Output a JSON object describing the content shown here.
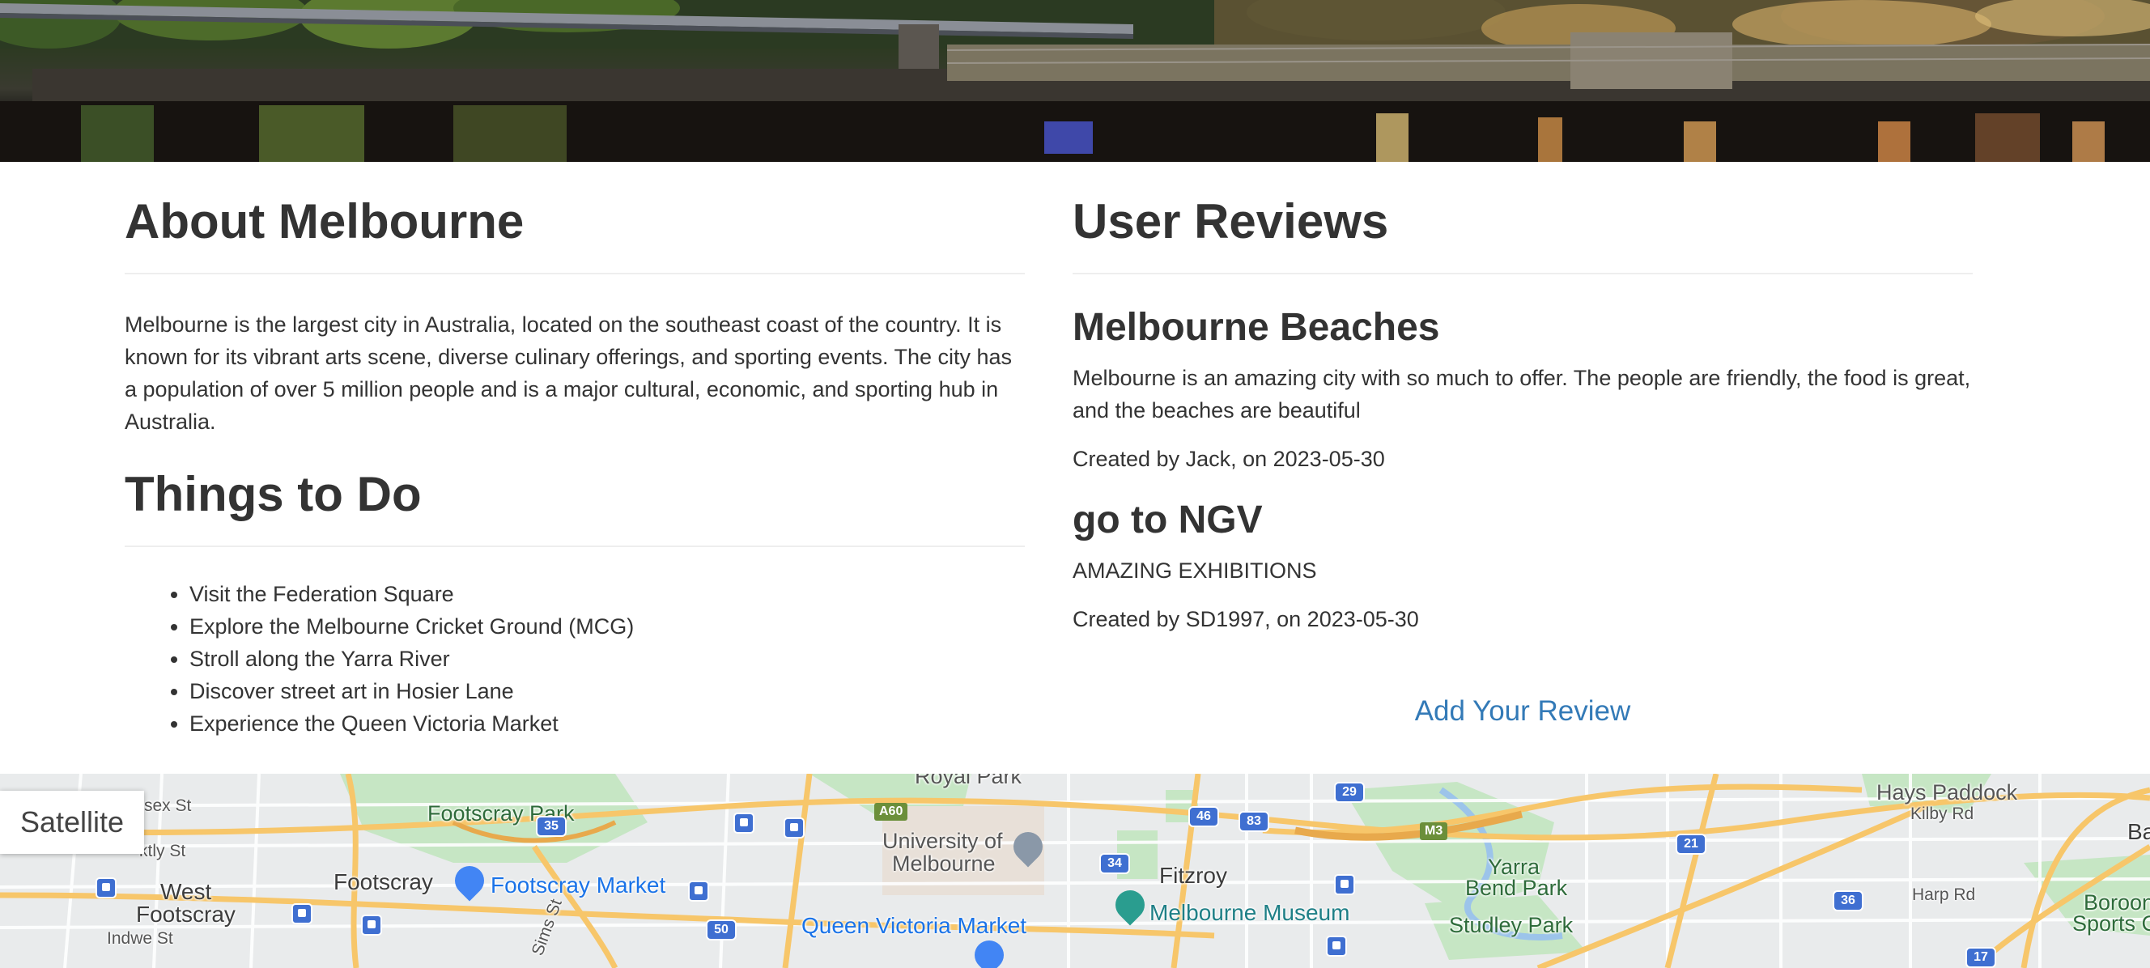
{
  "about": {
    "heading": "About Melbourne",
    "text": "Melbourne is the largest city in Australia, located on the southeast coast of the country. It is known for its vibrant arts scene, diverse culinary offerings, and sporting events. The city has a population of over 5 million people and is a major cultural, economic, and sporting hub in Australia."
  },
  "things": {
    "heading": "Things to Do",
    "items": [
      "Visit the Federation Square",
      "Explore the Melbourne Cricket Ground (MCG)",
      "Stroll along the Yarra River",
      "Discover street art in Hosier Lane",
      "Experience the Queen Victoria Market"
    ]
  },
  "reviews": {
    "heading": "User Reviews",
    "items": [
      {
        "title": "Melbourne Beaches",
        "body": "Melbourne is an amazing city with so much to offer. The people are friendly, the food is great, and the beaches are beautiful",
        "meta": "Created by Jack, on 2023-05-30"
      },
      {
        "title": "go to NGV",
        "body": "AMAZING EXHIBITIONS",
        "meta": "Created by SD1997, on 2023-05-30"
      }
    ],
    "add_label": "Add Your Review"
  },
  "map": {
    "satellite_label": "Satellite",
    "labels": {
      "royal_park": "Royal Park",
      "hays_paddock": "Hays Paddock",
      "kilby_rd": "Kilby Rd",
      "ba": "Ba",
      "sex_st": "sex St",
      "footscray_park": "Footscray Park",
      "a60": "A60",
      "uni_line1": "University of",
      "uni_line2": "Melbourne",
      "m3": "M3",
      "ktly_st": "ktly St",
      "west": "West",
      "footscray": "Footscray",
      "footscray_market": "Footscray Market",
      "fitzroy": "Fitzroy",
      "yarra_line1": "Yarra",
      "yarra_line2": "Bend Park",
      "harp_rd": "Harp Rd",
      "boroon_line1": "Boroon",
      "boroon_line2": "Sports Com",
      "west_footscray": "Footscray",
      "melbourne_museum": "Melbourne Museum",
      "studley_park": "Studley Park",
      "indwe_st": "Indwe St",
      "queen_vic_market": "Queen Victoria Market",
      "sims_st": "Sims St"
    },
    "route_badges": [
      "29",
      "35",
      "46",
      "83",
      "34",
      "21",
      "36",
      "50",
      "17"
    ]
  },
  "colors": {
    "link": "#337ab7",
    "text": "#333333",
    "rule": "#eeeeee",
    "map_bg": "#e9ebec",
    "park": "#c6e6c4",
    "road": "#f7c66a",
    "transit": "#3f6fd1"
  }
}
